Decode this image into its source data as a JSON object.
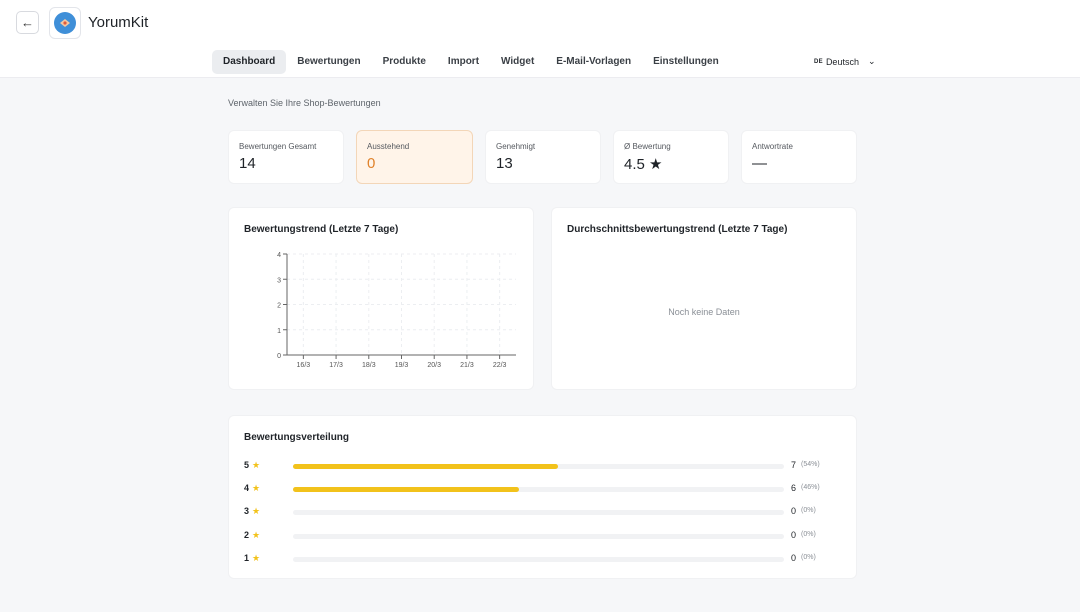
{
  "app": {
    "title": "YorumKit",
    "back_icon": "arrow-left-icon",
    "logo_icon": "app-logo-icon"
  },
  "nav": {
    "tabs": [
      {
        "label": "Dashboard",
        "active": true
      },
      {
        "label": "Bewertungen",
        "active": false
      },
      {
        "label": "Produkte",
        "active": false
      },
      {
        "label": "Import",
        "active": false
      },
      {
        "label": "Widget",
        "active": false
      },
      {
        "label": "E-Mail-Vorlagen",
        "active": false
      },
      {
        "label": "Einstellungen",
        "active": false
      }
    ]
  },
  "language": {
    "code": "DE",
    "label": "Deutsch",
    "icon": "chevron-down-icon"
  },
  "page": {
    "subtitle": "Verwalten Sie Ihre Shop-Bewertungen"
  },
  "stats": [
    {
      "label": "Bewertungen Gesamt",
      "value": "14"
    },
    {
      "label": "Ausstehend",
      "value": "0"
    },
    {
      "label": "Genehmigt",
      "value": "13"
    },
    {
      "label": "Ø Bewertung",
      "value": "4.5 ★"
    },
    {
      "label": "Antwortrate",
      "value": "—"
    }
  ],
  "trend_card": {
    "title": "Bewertungstrend (Letzte 7 Tage)"
  },
  "avg_card": {
    "title": "Durchschnittsbewertungstrend (Letzte 7 Tage)",
    "empty_text": "Noch keine Daten"
  },
  "chart_data": {
    "type": "line",
    "categories": [
      "16/3",
      "17/3",
      "18/3",
      "19/3",
      "20/3",
      "21/3",
      "22/3"
    ],
    "yticks": [
      0,
      1,
      2,
      3,
      4
    ],
    "ylim": [
      0,
      4
    ],
    "grid": true,
    "series": []
  },
  "distribution": {
    "title": "Bewertungsverteilung",
    "star_icon": "star-icon",
    "accent_color": "#f2c21b",
    "rows": [
      {
        "stars": "5",
        "star": "★",
        "count": "7",
        "percent": "(54%)",
        "fraction": 0.54
      },
      {
        "stars": "4",
        "star": "★",
        "count": "6",
        "percent": "(46%)",
        "fraction": 0.46
      },
      {
        "stars": "3",
        "star": "★",
        "count": "0",
        "percent": "(0%)",
        "fraction": 0
      },
      {
        "stars": "2",
        "star": "★",
        "count": "0",
        "percent": "(0%)",
        "fraction": 0
      },
      {
        "stars": "1",
        "star": "★",
        "count": "0",
        "percent": "(0%)",
        "fraction": 0
      }
    ]
  }
}
